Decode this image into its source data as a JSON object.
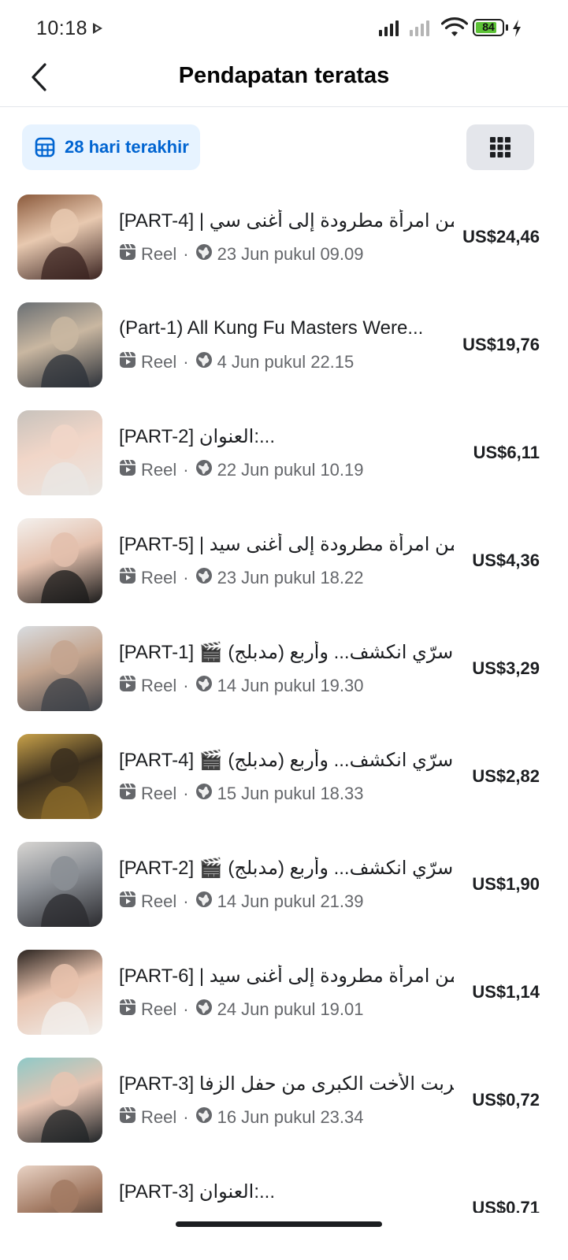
{
  "status_bar": {
    "time": "10:18",
    "battery": "84",
    "battery_level": 0.84
  },
  "header": {
    "title": "Pendapatan teratas",
    "back_icon": "chevron-left-icon"
  },
  "filter": {
    "label": "28 hari terakhir",
    "icon": "calendar-grid-icon",
    "view_toggle_icon": "grid-icon"
  },
  "colors": {
    "accent": "#0064d1",
    "chip_bg": "#e7f3ff",
    "secondary_text": "#65676b"
  },
  "items": [
    {
      "title": "[PART-4] | من امرأة مطرودة إلى أغنى سي...",
      "type": "Reel",
      "date": "23 Jun pukul 09.09",
      "amount": "US$24,46",
      "thumb_colors": [
        "#3a2320",
        "#8b5a3c",
        "#e8c9b0"
      ]
    },
    {
      "title": "(Part-1) All Kung Fu Masters Were...",
      "type": "Reel",
      "date": "4 Jun pukul 22.15",
      "amount": "US$19,76",
      "thumb_colors": [
        "#2b3038",
        "#6a6f73",
        "#c9b7a1"
      ]
    },
    {
      "title": "[PART-2] العنوان:...",
      "type": "Reel",
      "date": "22 Jun pukul 10.19",
      "amount": "US$6,11",
      "thumb_colors": [
        "#e9e7e4",
        "#c7c2bc",
        "#f1d6c8"
      ]
    },
    {
      "title": "[PART-5] | من امرأة مطرودة إلى أغنى سيد...",
      "type": "Reel",
      "date": "23 Jun pukul 18.22",
      "amount": "US$4,36",
      "thumb_colors": [
        "#1a1a1a",
        "#f4f1ee",
        "#e3c0ad"
      ]
    },
    {
      "title": "[PART-1] 🎬 (مدبلج) سرّي انكشف... وأربع...",
      "type": "Reel",
      "date": "14 Jun pukul 19.30",
      "amount": "US$3,29",
      "thumb_colors": [
        "#3d4148",
        "#d9dde1",
        "#c4a58f"
      ]
    },
    {
      "title": "[PART-4] 🎬 (مدبلج) سرّي انكشف... وأربع...",
      "type": "Reel",
      "date": "15 Jun pukul 18.33",
      "amount": "US$2,82",
      "thumb_colors": [
        "#8a6a2a",
        "#c9a24a",
        "#3b2f1e"
      ]
    },
    {
      "title": "[PART-2] 🎬 (مدبلج) سرّي انكشف... وأربع...",
      "type": "Reel",
      "date": "14 Jun pukul 21.39",
      "amount": "US$1,90",
      "thumb_colors": [
        "#2a2a2e",
        "#d8d6d3",
        "#8b8f95"
      ]
    },
    {
      "title": "[PART-6] | من امرأة مطرودة إلى أغنى سيد...",
      "type": "Reel",
      "date": "24 Jun pukul 19.01",
      "amount": "US$1,14",
      "thumb_colors": [
        "#f2efec",
        "#2b2420",
        "#e7c2ad"
      ]
    },
    {
      "title": "[PART-3] هربت الأخت الكبرى من حفل الزفا...",
      "type": "Reel",
      "date": "16 Jun pukul 23.34",
      "amount": "US$0,72",
      "thumb_colors": [
        "#1f2326",
        "#8fc9c7",
        "#e6c4b2"
      ]
    },
    {
      "title": "[PART-3] العنوان:...",
      "type": "Reel",
      "date": "",
      "amount": "US$0,71",
      "thumb_colors": [
        "#141414",
        "#e9d3c5",
        "#a27a63"
      ]
    }
  ]
}
